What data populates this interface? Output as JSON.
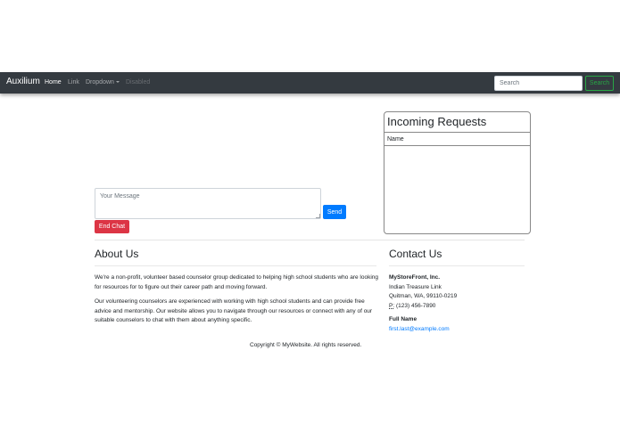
{
  "navbar": {
    "brand": "Auxilium",
    "links": [
      "Home",
      "Link",
      "Dropdown",
      "Disabled"
    ],
    "search_placeholder": "Search",
    "search_button": "Search"
  },
  "chat": {
    "message_placeholder": "Your Message",
    "send_label": "Send",
    "end_label": "End Chat"
  },
  "requests": {
    "title": "Incoming Requests",
    "column": "Name"
  },
  "about": {
    "title": "About Us",
    "p1": "We're a non-profit, volunteer based counselor group dedicated to helping high school students who are looking for resources for to figure out their career path and moving forward.",
    "p2": "Our volunteering counselors are experienced with working with high school students and can provide free advice and mentorship. Our website allows you to navigate through our resources or connect with any of our suitable counselors to chat with them about anything specific."
  },
  "contact": {
    "title": "Contact Us",
    "company": "MyStoreFront, Inc.",
    "street": "Indian Treasure Link",
    "city": "Quitman, WA, 99110-0219",
    "phone_label": "P:",
    "phone": "(123) 456-7890",
    "name": "Full Name",
    "email": "first.last@example.com"
  },
  "footer": {
    "copyright": "Copyright © MyWebsite. All rights reserved."
  },
  "colors": {
    "navbar": "#343a40",
    "primary": "#007bff",
    "danger": "#dc3545",
    "success": "#28a745"
  }
}
